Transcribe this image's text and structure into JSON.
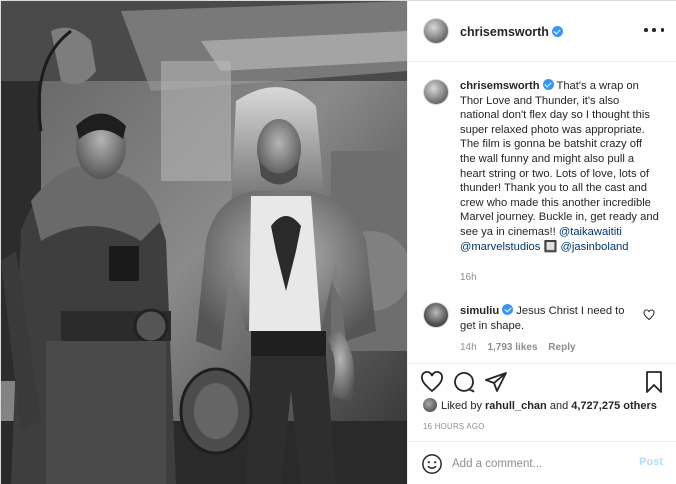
{
  "post": {
    "author": "chrisemsworth",
    "more_icon": "more-horizontal-icon",
    "photo_description_icon": "photo"
  },
  "caption": {
    "username": "chrisemsworth",
    "text": "That's a wrap on Thor Love and Thunder, it's also national don't flex day so I thought this super relaxed photo was appropriate. The film is gonna be batshit crazy off the wall funny and might also pull a heart string or two. Lots of love, lots of thunder! Thank you to all the cast and crew who made this another incredible Marvel journey. Buckle in, get ready and see ya in cinemas!! ",
    "tag1": "@taikawaititi",
    "tag2": "@marvelstudios",
    "emoji": "🔲",
    "tag3": "@jasinboland",
    "time": "16h"
  },
  "comment": {
    "username": "simuliu",
    "text": "Jesus Christ I need to get in shape.",
    "time": "14h",
    "likes": "1,793 likes",
    "reply": "Reply"
  },
  "likes": {
    "prefix": "Liked by ",
    "user": "rahull_chan",
    "middle": " and ",
    "count": "4,727,275 others"
  },
  "timestamp": "16 HOURS AGO",
  "add_comment": {
    "placeholder": "Add a comment...",
    "post_label": "Post"
  },
  "colors": {
    "verified": "#3897f0",
    "link": "#00376b",
    "muted": "#8e8e8e",
    "post_disabled": "#b2dffc"
  }
}
